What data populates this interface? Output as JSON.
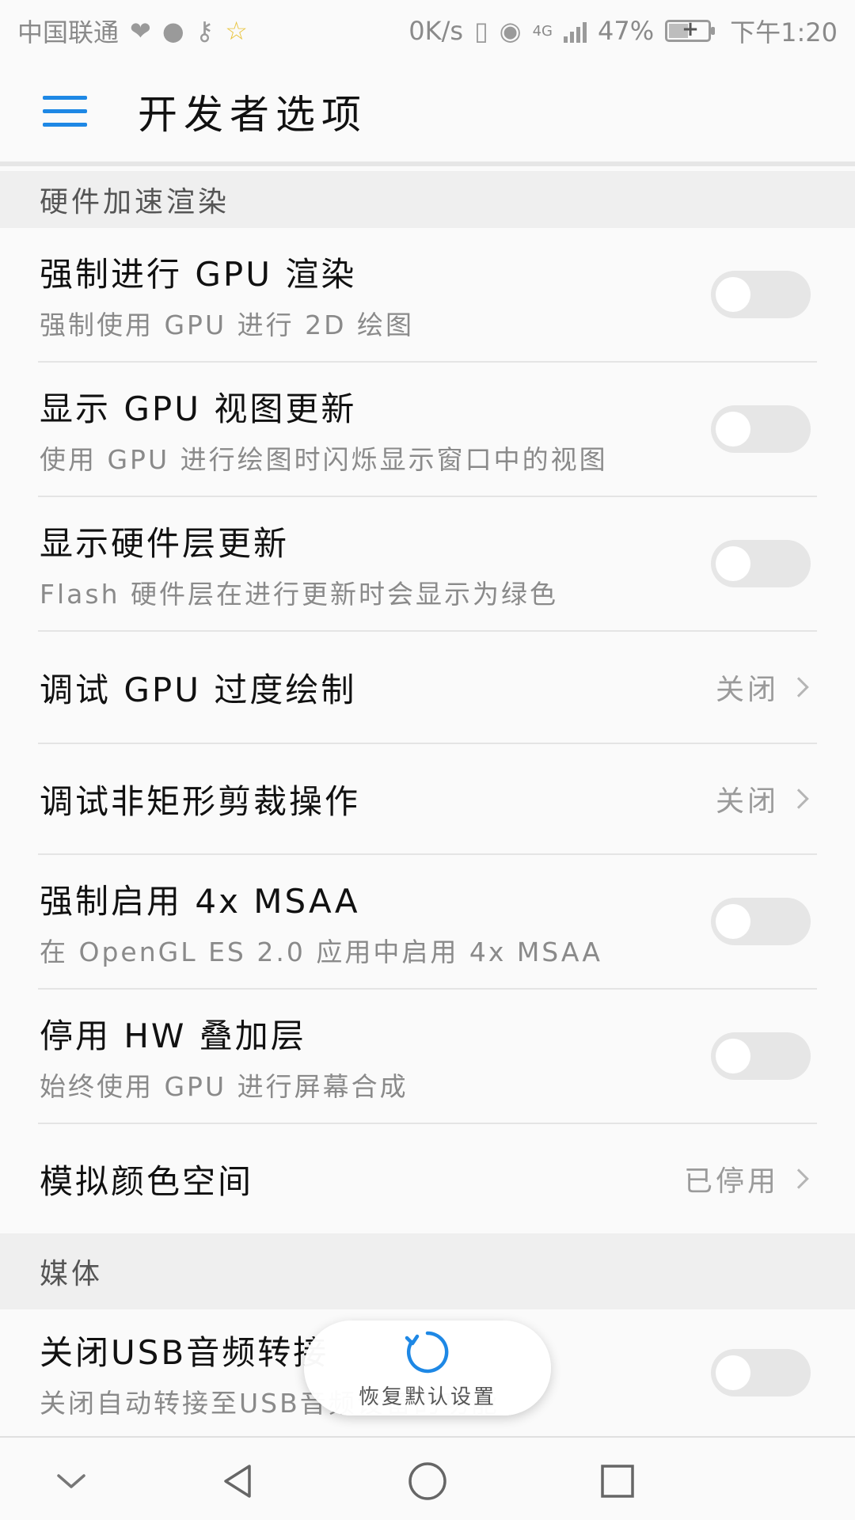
{
  "status_bar": {
    "carrier": "中国联通",
    "speed": "0K/s",
    "network": "4G",
    "battery": "47%",
    "time": "下午1:20",
    "icons": [
      "heart-pulse-icon",
      "chat-bubble-icon",
      "key-icon",
      "star-icon",
      "vibrate-icon",
      "eye-icon",
      "signal-icon",
      "battery-charging-icon"
    ]
  },
  "app_bar": {
    "title": "开发者选项",
    "menu_icon": "hamburger-menu-icon"
  },
  "sections": [
    {
      "header": "硬件加速渲染",
      "items": [
        {
          "title": "强制进行 GPU 渲染",
          "subtitle": "强制使用 GPU 进行 2D 绘图",
          "control": "toggle",
          "enabled": false
        },
        {
          "title": "显示 GPU 视图更新",
          "subtitle": "使用 GPU 进行绘图时闪烁显示窗口中的视图",
          "control": "toggle",
          "enabled": false
        },
        {
          "title": "显示硬件层更新",
          "subtitle": "Flash 硬件层在进行更新时会显示为绿色",
          "control": "toggle",
          "enabled": false
        },
        {
          "title": "调试 GPU 过度绘制",
          "value": "关闭",
          "control": "chevron"
        },
        {
          "title": "调试非矩形剪裁操作",
          "value": "关闭",
          "control": "chevron"
        },
        {
          "title": "强制启用 4x MSAA",
          "subtitle": "在 OpenGL ES 2.0 应用中启用 4x MSAA",
          "control": "toggle",
          "enabled": false
        },
        {
          "title": "停用 HW 叠加层",
          "subtitle": "始终使用 GPU 进行屏幕合成",
          "control": "toggle",
          "enabled": false
        },
        {
          "title": "模拟颜色空间",
          "value": "已停用",
          "control": "chevron"
        }
      ]
    },
    {
      "header": "媒体",
      "items": [
        {
          "title": "关闭USB音频转接",
          "subtitle": "关闭自动转接至USB音频设备的功能",
          "control": "toggle",
          "enabled": false
        }
      ]
    }
  ],
  "restore_button": {
    "label": "恢复默认设置",
    "icon": "refresh-icon",
    "accent": "#1e88e5"
  },
  "nav_bar": {
    "icons": [
      "collapse-chevron-icon",
      "back-triangle-icon",
      "home-circle-icon",
      "recents-square-icon"
    ]
  },
  "colors": {
    "accent": "#1e88e5",
    "toggle_off": "#e6e6e6",
    "section_bg": "#efefef"
  }
}
